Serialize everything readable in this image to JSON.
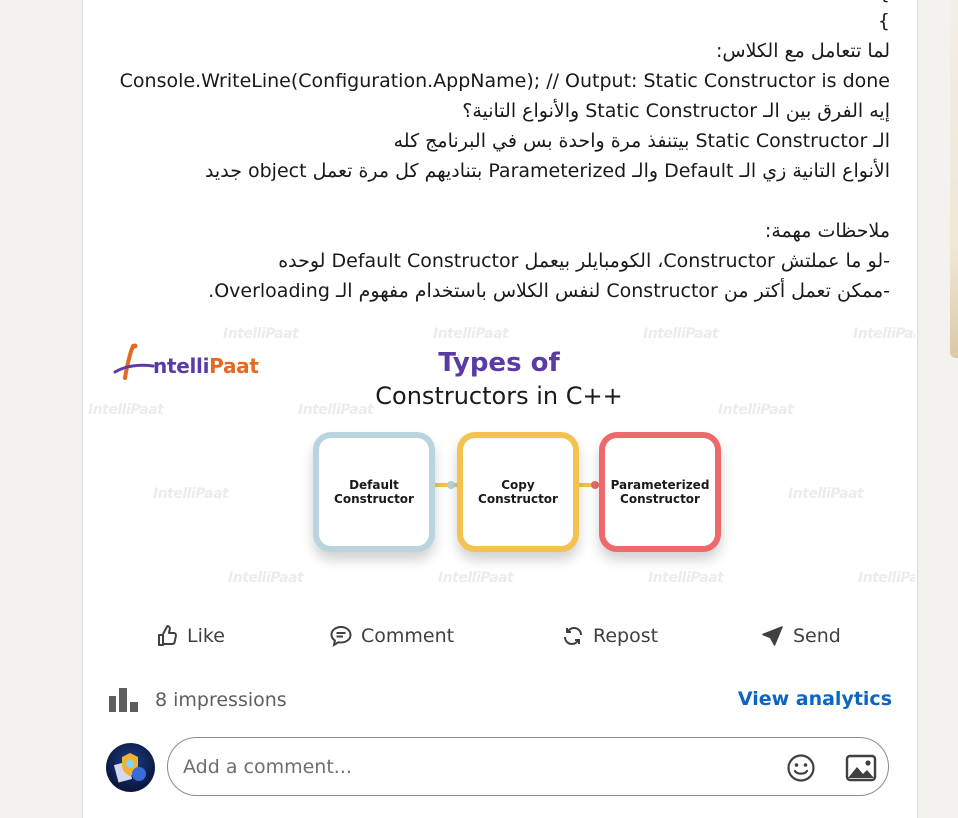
{
  "post": {
    "brace_line": "}",
    "lines": [
      "لما تتعامل مع الكلاس:",
      "Console.WriteLine(Configuration.AppName); // Output: Static Constructor is done",
      "إيه الفرق بين الـ Static Constructor والأنواع التانية؟",
      "الـ Static Constructor بيتنفذ مرة واحدة بس في البرنامج كله",
      "الأنواع التانية زي الـ Default والـ Parameterized بتناديهم كل مرة تعمل object جديد",
      "ملاحظات مهمة:",
      "-لو ما عملتش Constructor، الكومبايلر بيعمل Default Constructor لوحده",
      "-ممكن تعمل أكتر من Constructor لنفس الكلاس باستخدام مفهوم الـ Overloading."
    ]
  },
  "image": {
    "logo": {
      "part1": "ntelli",
      "part2": "Paat",
      "watermark": "IntelliPaat"
    },
    "title_line1": "Types of",
    "title_line2": "Constructors in C++",
    "boxes": [
      {
        "line1": "Default",
        "line2": "Constructor",
        "color": "#b9d3df"
      },
      {
        "line1": "Copy",
        "line2": "Constructor",
        "color": "#f4c24f"
      },
      {
        "line1": "Parameterized",
        "line2": "Constructor",
        "color": "#ee6a6a"
      }
    ]
  },
  "actions": {
    "like": "Like",
    "comment": "Comment",
    "repost": "Repost",
    "send": "Send"
  },
  "stats": {
    "impressions": "8 impressions",
    "view_analytics": "View analytics"
  },
  "comment_input": {
    "placeholder": "Add a comment..."
  },
  "colors": {
    "link_blue": "#0a66c2",
    "brand_purple": "#5b3aa5",
    "brand_orange": "#e46a1e"
  },
  "icons": [
    "like-icon",
    "comment-icon",
    "repost-icon",
    "send-icon",
    "impressions-chart-icon",
    "emoji-icon",
    "image-icon"
  ]
}
